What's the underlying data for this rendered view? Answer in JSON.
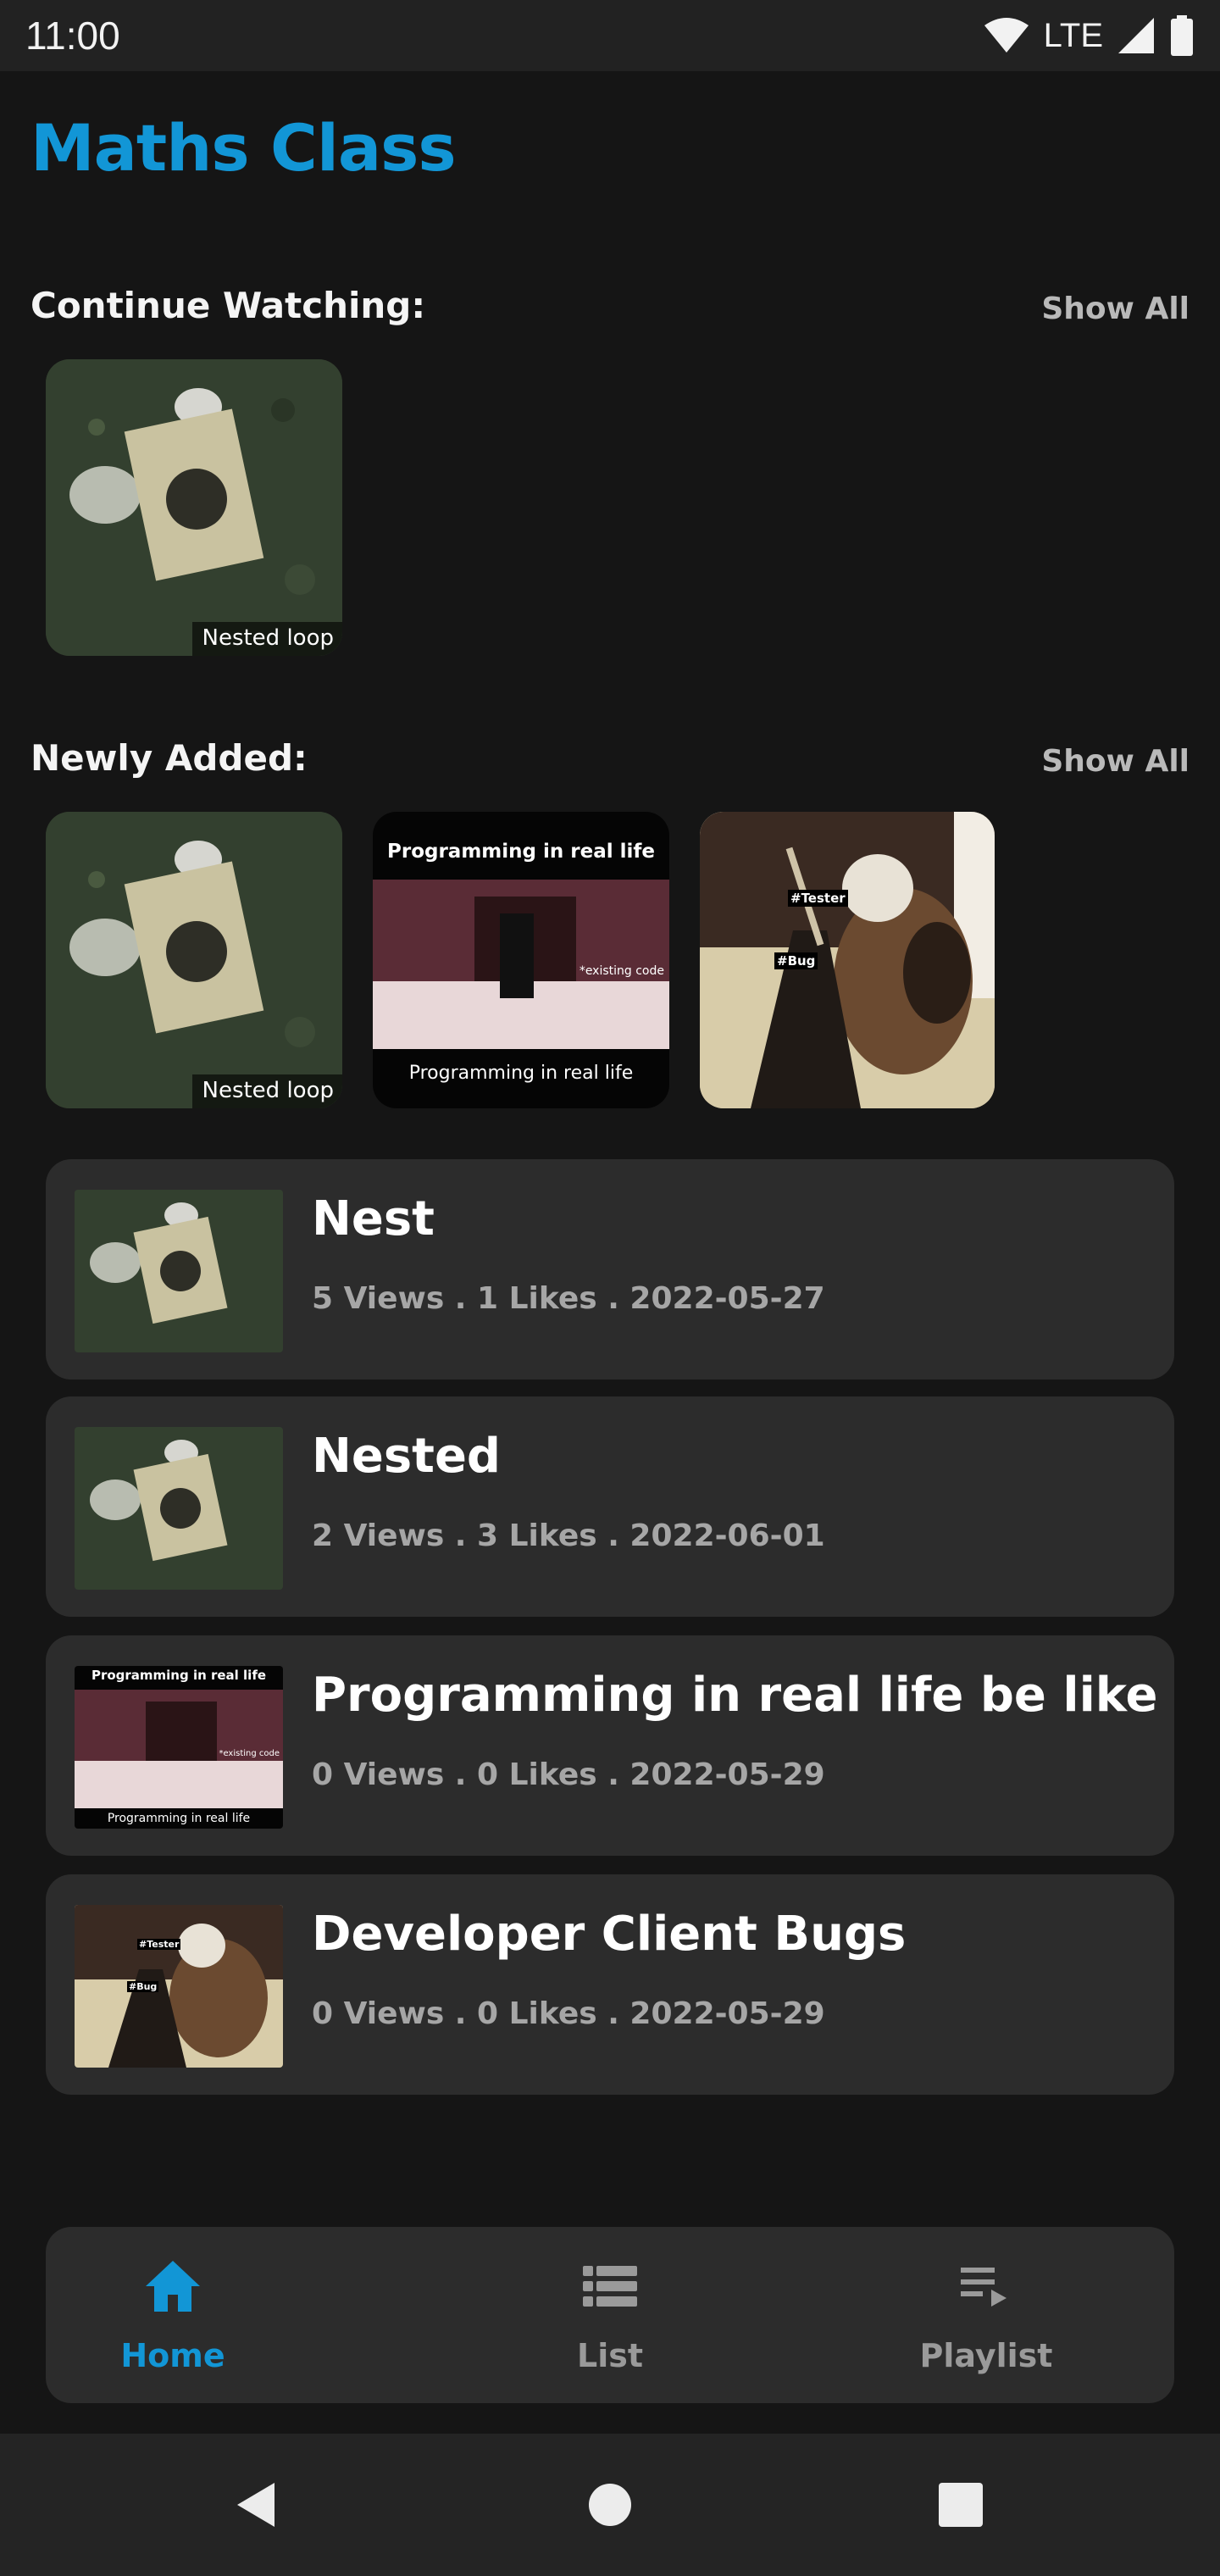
{
  "status_bar": {
    "time": "11:00",
    "network": "LTE"
  },
  "app": {
    "title": "Maths Class"
  },
  "continue_watching": {
    "title": "Continue Watching:",
    "show_all": "Show All",
    "items": [
      {
        "label": "Nested loop"
      }
    ]
  },
  "newly_added": {
    "title": "Newly Added:",
    "show_all": "Show All",
    "items": [
      {
        "label": "Nested loop"
      },
      {
        "top_text": "Programming in real life",
        "bottom_text": "Programming in real life",
        "overlay_text": "*existing code"
      },
      {
        "tags": [
          "#Tester",
          "#Bug"
        ]
      }
    ]
  },
  "videos": [
    {
      "title": "Nest",
      "meta": "5 Views . 1 Likes . 2022-05-27"
    },
    {
      "title": "Nested",
      "meta": "2 Views . 3 Likes . 2022-06-01"
    },
    {
      "title": "Programming in real life be like",
      "meta": "0 Views . 0 Likes . 2022-05-29",
      "thumb_top": "Programming in real life",
      "thumb_bottom": "Programming in real life",
      "thumb_overlay": "*existing code"
    },
    {
      "title": "Developer Client Bugs",
      "meta": "0 Views . 0 Likes . 2022-05-29",
      "thumb_tags": [
        "#Tester",
        "#Bug"
      ]
    }
  ],
  "nav": {
    "home": "Home",
    "list": "List",
    "playlist": "Playlist",
    "active_color": "#1296d6",
    "inactive_color": "#9a9a9a"
  }
}
